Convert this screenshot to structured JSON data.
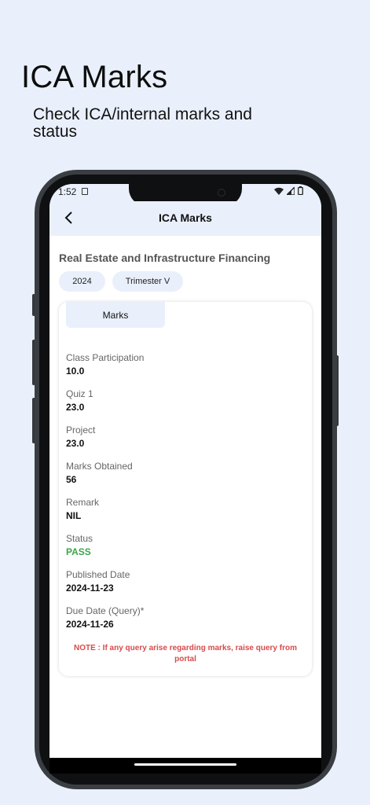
{
  "hero": {
    "title": "ICA Marks",
    "subtitle": "Check ICA/internal marks and status"
  },
  "status_bar": {
    "time": "1:52"
  },
  "app_bar": {
    "title": "ICA Marks"
  },
  "course": {
    "name": "Real Estate and Infrastructure Financing",
    "year": "2024",
    "trimester": "Trimester V"
  },
  "card": {
    "tab_label": "Marks",
    "fields": [
      {
        "label": "Class Participation",
        "value": "10.0"
      },
      {
        "label": "Quiz 1",
        "value": "23.0"
      },
      {
        "label": "Project",
        "value": "23.0"
      },
      {
        "label": "Marks Obtained",
        "value": "56"
      },
      {
        "label": "Remark",
        "value": "NIL"
      },
      {
        "label": "Status",
        "value": "PASS"
      },
      {
        "label": "Published Date",
        "value": "2024-11-23"
      },
      {
        "label": "Due Date (Query)*",
        "value": "2024-11-26"
      }
    ],
    "note": "NOTE : If any query arise regarding marks, raise query from portal"
  },
  "colors": {
    "background": "#e9f0fb",
    "status_pass": "#3ca64a",
    "note_red": "#d84a4a"
  }
}
